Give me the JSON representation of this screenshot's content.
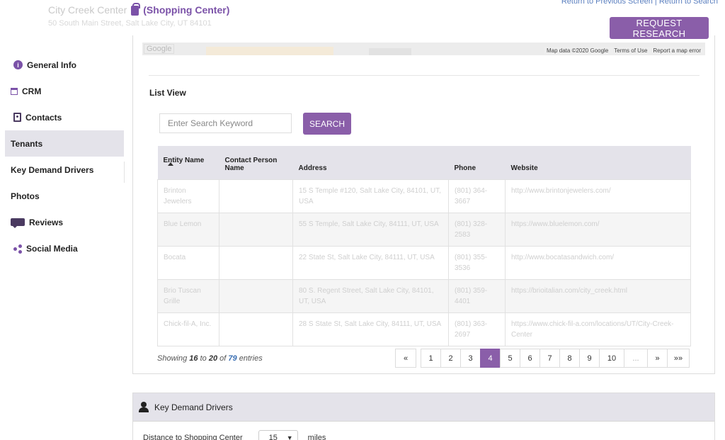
{
  "header": {
    "center_name": "City Creek Center",
    "center_type": "(Shopping Center)",
    "address": "50 South Main Street, Salt Lake City, UT 84101",
    "return_previous": "Return to Previous Screen",
    "separator": "|",
    "return_search": "Return to Search",
    "request_research": "REQUEST RESEARCH"
  },
  "sidebar": {
    "items": [
      {
        "label": "General Info",
        "icon": "info-icon"
      },
      {
        "label": "CRM",
        "icon": "calendar-icon"
      },
      {
        "label": "Contacts",
        "icon": "contact-card-icon"
      },
      {
        "label": "Tenants",
        "icon": ""
      },
      {
        "label": "Key Demand Drivers",
        "icon": ""
      },
      {
        "label": "Photos",
        "icon": ""
      },
      {
        "label": "Reviews",
        "icon": "comment-icon"
      },
      {
        "label": "Social Media",
        "icon": "share-icon"
      }
    ],
    "active": "Tenants"
  },
  "map": {
    "logo": "Google",
    "attribution": "Map data ©2020 Google",
    "terms": "Terms of Use",
    "report": "Report a map error"
  },
  "list": {
    "title": "List View",
    "search_placeholder": "Enter Search Keyword",
    "search_button": "SEARCH",
    "columns": [
      "Entity Name",
      "Contact Person Name",
      "Address",
      "Phone",
      "Website"
    ],
    "rows": [
      {
        "entity": "Brinton Jewelers",
        "contact": "",
        "address": "15 S Temple #120, Salt Lake City, 84101, UT, USA",
        "phone": "(801) 364-3667",
        "website": "http://www.brintonjewelers.com/"
      },
      {
        "entity": "Blue Lemon",
        "contact": "",
        "address": "55 S Temple, Salt Lake City, 84111, UT, USA",
        "phone": "(801) 328-2583",
        "website": "https://www.bluelemon.com/"
      },
      {
        "entity": "Bocata",
        "contact": "",
        "address": "22 State St, Salt Lake City, 84111, UT, USA",
        "phone": "(801) 355-3536",
        "website": "http://www.bocatasandwich.com/"
      },
      {
        "entity": "Brio Tuscan Grille",
        "contact": "",
        "address": "80 S. Regent Street, Salt Lake City, 84101, UT, USA",
        "phone": "(801) 359-4401",
        "website": "https://brioitalian.com/city_creek.html"
      },
      {
        "entity": "Chick-fil-A, Inc.",
        "contact": "",
        "address": "28 S State St, Salt Lake City, 84111, UT, USA",
        "phone": "(801) 363-2697",
        "website": "https://www.chick-fil-a.com/locations/UT/City-Creek-Center"
      }
    ],
    "showing_prefix": "Showing",
    "from": "16",
    "to_word": "to",
    "to": "20",
    "of_word": "of",
    "total": "79",
    "entries_word": "entries"
  },
  "pagination": {
    "first": "«",
    "pages": [
      "1",
      "2",
      "3",
      "4",
      "5",
      "6",
      "7",
      "8",
      "9",
      "10"
    ],
    "active_page": "4",
    "ellipsis": "...",
    "next": "»",
    "last": "»»"
  },
  "key_demand": {
    "title": "Key Demand Drivers",
    "distance_label": "Distance to Shopping Center",
    "distance_value": "15",
    "unit": "miles"
  },
  "colors": {
    "accent": "#8a5ea9",
    "header_bg": "#e4e3ea",
    "link": "#5a7fbf"
  }
}
